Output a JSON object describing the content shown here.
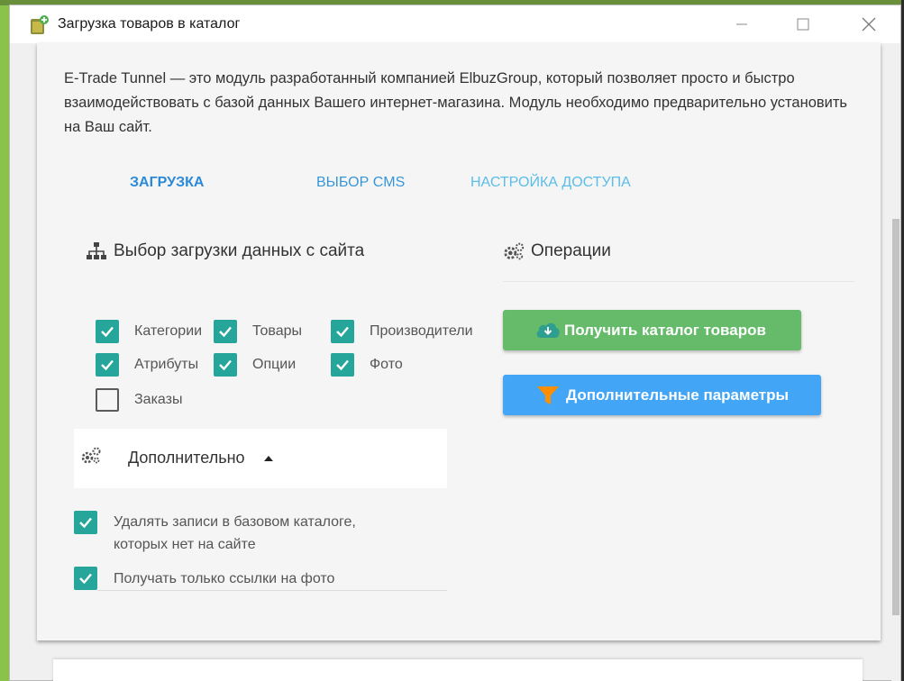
{
  "window": {
    "title": "Загрузка товаров в каталог",
    "app_icon": "catalog-upload-icon",
    "controls": {
      "minimize": "minimize-icon",
      "maximize": "maximize-icon",
      "close": "close-icon"
    }
  },
  "description": "E-Trade Tunnel — это модуль разработанный компанией ElbuzGroup, который позволяет просто и быстро взаимодействовать с базой данных Вашего интернет-магазина. Модуль необходимо предварительно установить на Ваш сайт.",
  "tabs": [
    {
      "label": "ЗАГРУЗКА",
      "active": true
    },
    {
      "label": "ВЫБОР CMS",
      "active": false
    },
    {
      "label": "НАСТРОЙКА ДОСТУПА",
      "active": false
    }
  ],
  "data_selection": {
    "title": "Выбор загрузки данных с сайта",
    "icon": "sitemap-icon",
    "items": [
      {
        "label": "Категории",
        "checked": true
      },
      {
        "label": "Товары",
        "checked": true
      },
      {
        "label": "Производители",
        "checked": true
      },
      {
        "label": "Атрибуты",
        "checked": true
      },
      {
        "label": "Опции",
        "checked": true
      },
      {
        "label": "Фото",
        "checked": true
      },
      {
        "label": "Заказы",
        "checked": false
      }
    ]
  },
  "additional": {
    "label": "Дополнительно",
    "icon": "gears-icon",
    "caret": "caret-up-icon",
    "options": [
      {
        "label": "Удалять записи в базовом каталоге, которых нет на сайте",
        "checked": true
      },
      {
        "label": "Получать только ссылки на фото",
        "checked": true
      }
    ]
  },
  "operations": {
    "title": "Операции",
    "icon": "gears-icon",
    "get_catalog_label": "Получить каталог товаров",
    "get_catalog_icon": "cloud-download-icon",
    "extra_params_label": "Дополнительные параметры",
    "extra_params_icon": "funnel-icon"
  },
  "colors": {
    "checkbox": "#26a69a",
    "green_button": "#66bb6a",
    "blue_button": "#42a5f5",
    "active_tab": "#2a8ad8",
    "inactive_tab": "#5cbde8"
  }
}
